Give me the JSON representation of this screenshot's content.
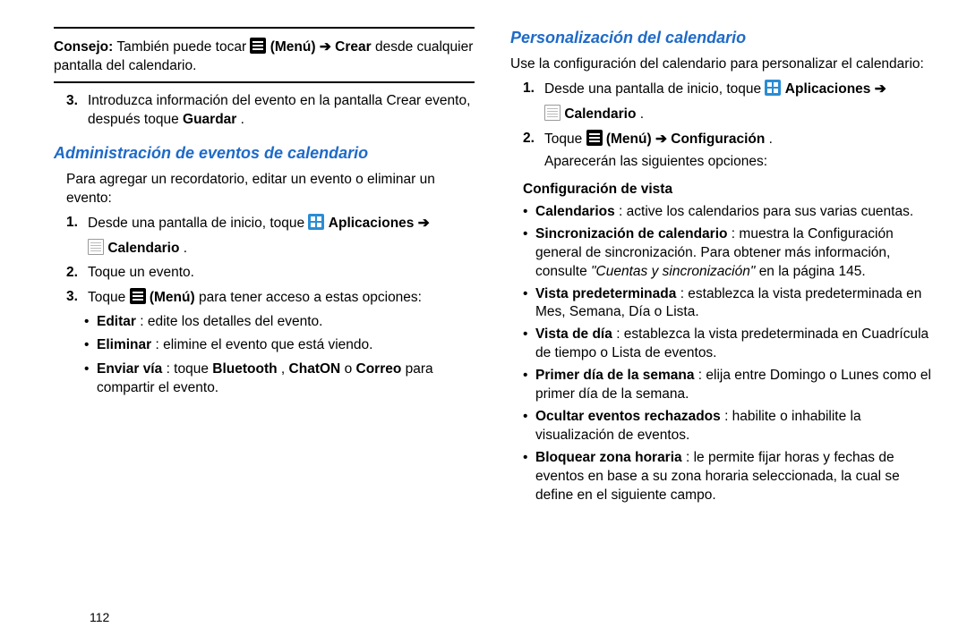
{
  "left": {
    "tip_label": "Consejo:",
    "tip_text": " También puede tocar ",
    "tip_menu_label": "(Menú)",
    "tip_arrow": " ➔ ",
    "tip_crear": "Crear",
    "tip_tail": " desde cualquier pantalla del calendario.",
    "step3_pre": "Introduzca información del evento en la pantalla Crear evento, después toque ",
    "step3_bold": "Guardar",
    "step3_tail": ".",
    "h1": "Administración de eventos de calendario",
    "intro": "Para agregar un recordatorio, editar un evento o eliminar un evento:",
    "s1_pre": "Desde una pantalla de inicio, toque ",
    "s1_apps": "Aplicaciones",
    "s1_arrow": " ➔",
    "s1_cal": "Calendario",
    "s1_tail": ".",
    "s2": "Toque un evento.",
    "s3_pre": "Toque ",
    "s3_menu": "(Menú)",
    "s3_tail": " para tener acceso a estas opciones:",
    "b1_a": "Editar",
    "b1_b": ": edite los detalles del evento.",
    "b2_a": "Eliminar",
    "b2_b": ": elimine el evento que está viendo.",
    "b3_a": "Enviar vía",
    "b3_b": ": toque ",
    "b3_c": "Bluetooth",
    "b3_d": ", ",
    "b3_e": "ChatON",
    "b3_f": " o ",
    "b3_g": "Correo",
    "b3_h": " para compartir el evento."
  },
  "right": {
    "h1": "Personalización del calendario",
    "intro": "Use la configuración del calendario para personalizar el calendario:",
    "s1_pre": "Desde una pantalla de inicio, toque ",
    "s1_apps": "Aplicaciones",
    "s1_arrow": " ➔",
    "s1_cal": "Calendario",
    "s1_tail": ".",
    "s2_pre": "Toque ",
    "s2_menu": "(Menú)",
    "s2_arrow": " ➔ ",
    "s2_conf": "Configuración",
    "s2_tail": ".",
    "s2_line2": "Aparecerán las siguientes opciones:",
    "sub1": "Configuración de vista",
    "ba_a": "Calendarios",
    "ba_b": ": active los calendarios para sus varias cuentas.",
    "bb_a": "Sincronización de calendario",
    "bb_b": ": muestra la Configuración general de sincronización. Para obtener más información, consulte ",
    "bb_c": "\"Cuentas y sincronización\"",
    "bb_d": " en la página 145.",
    "bc_a": "Vista predeterminada",
    "bc_b": ": establezca la vista predeterminada en Mes, Semana, Día o Lista.",
    "bd_a": "Vista de día",
    "bd_b": ": establezca la vista predeterminada en Cuadrícula de tiempo o Lista de eventos.",
    "be_a": "Primer día de la semana",
    "be_b": ": elija entre Domingo o Lunes como el primer día de la semana.",
    "bf_a": "Ocultar eventos rechazados",
    "bf_b": ": habilite o inhabilite la visualización de eventos.",
    "bg_a": "Bloquear zona horaria",
    "bg_b": ": le permite fijar horas y fechas de eventos en base a su zona horaria seleccionada, la cual se define en el siguiente campo."
  },
  "pagenum": "112"
}
